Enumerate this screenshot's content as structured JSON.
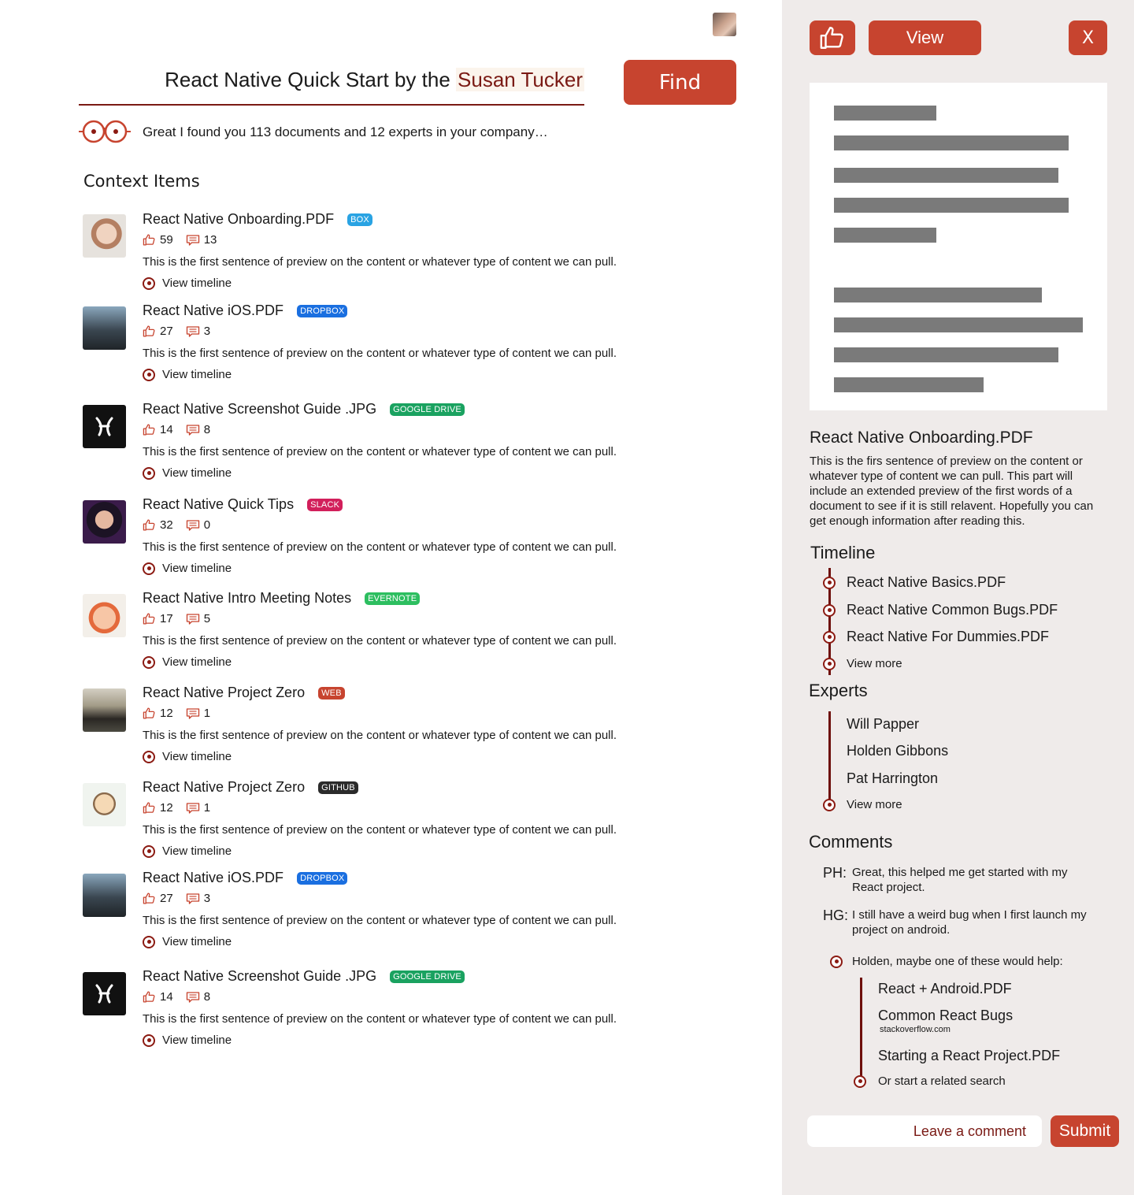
{
  "search": {
    "query_prefix": "React Native Quick Start by the ",
    "query_highlight": "Susan Tucker",
    "find_label": "Find"
  },
  "status": {
    "message": "Great I found you 113 documents and 12 experts in your company…"
  },
  "context": {
    "title": "Context Items",
    "preview_text": "This is the first sentence of preview on the content or whatever type of content we can pull.",
    "view_timeline_label": "View timeline",
    "items": [
      {
        "title": "React Native Onboarding.PDF",
        "source": "BOX",
        "source_color": "#29a3e3",
        "likes": "59",
        "comments": "13",
        "thumb": "woman"
      },
      {
        "title": "React Native iOS.PDF",
        "source": "DROPBOX",
        "source_color": "#1a6fe0",
        "likes": "27",
        "comments": "3",
        "thumb": "laptop"
      },
      {
        "title": "React Native Screenshot Guide .JPG",
        "source": "GOOGLE DRIVE",
        "source_color": "#1aa260",
        "likes": "14",
        "comments": "8",
        "thumb": "logo"
      },
      {
        "title": "React Native Quick Tips",
        "source": "SLACK",
        "source_color": "#d21f5b",
        "likes": "32",
        "comments": "0",
        "thumb": "girl"
      },
      {
        "title": "React Native Intro Meeting Notes",
        "source": "EVERNOTE",
        "source_color": "#2dbe60",
        "likes": "17",
        "comments": "5",
        "thumb": "toy"
      },
      {
        "title": "React Native Project Zero",
        "source": "WEB",
        "source_color": "#c7442f",
        "likes": "12",
        "comments": "1",
        "thumb": "man"
      },
      {
        "title": "React Native Project Zero",
        "source": "GITHUB",
        "source_color": "#2b2b2b",
        "likes": "12",
        "comments": "1",
        "thumb": "cartoon"
      },
      {
        "title": "React Native iOS.PDF",
        "source": "DROPBOX",
        "source_color": "#1a6fe0",
        "likes": "27",
        "comments": "3",
        "thumb": "laptop"
      },
      {
        "title": "React Native Screenshot Guide .JPG",
        "source": "GOOGLE DRIVE",
        "source_color": "#1aa260",
        "likes": "14",
        "comments": "8",
        "thumb": "logo"
      }
    ]
  },
  "panel": {
    "view_label": "View",
    "close_label": "X",
    "doc_title": "React Native Onboarding.PDF",
    "doc_description": "This is the firs sentence of preview on the content or whatever type of content we can pull.  This part will include an extended preview of the first words of a document to see if it is still relavent. Hopefully you can get enough information after reading this.",
    "timeline_title": "Timeline",
    "timeline_items": [
      "React Native Basics.PDF",
      "React Native Common Bugs.PDF",
      "React Native For Dummies.PDF"
    ],
    "view_more": "View more",
    "experts_title": "Experts",
    "experts": [
      "Will Papper",
      "Holden Gibbons",
      "Pat Harrington"
    ],
    "comments_title": "Comments",
    "comments": [
      {
        "initials": "PH:",
        "text": "Great, this helped me get started with my React project."
      },
      {
        "initials": "HG:",
        "text": "I still have a weird bug when I first launch my project on android."
      }
    ],
    "suggestion_intro": "Holden, maybe one of these would help:",
    "suggestions": [
      {
        "title": "React + Android.PDF",
        "sub": ""
      },
      {
        "title": "Common React Bugs",
        "sub": "stackoverflow.com"
      },
      {
        "title": "Starting a React Project.PDF",
        "sub": ""
      }
    ],
    "related_search": "Or start a related search",
    "comment_placeholder": "Leave a comment",
    "submit_label": "Submit"
  },
  "colors": {
    "accent": "#c7442f",
    "dark_red": "#7a1a14",
    "panel_bg": "#efebea"
  }
}
